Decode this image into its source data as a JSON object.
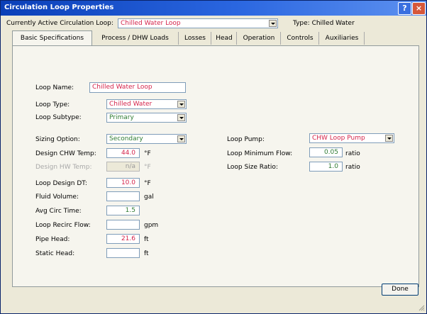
{
  "window": {
    "title": "Circulation Loop Properties",
    "help_label": "?",
    "close_label": "×"
  },
  "header": {
    "active_loop_label": "Currently Active Circulation Loop:",
    "active_loop_value": "Chilled Water Loop",
    "type_label": "Type: Chilled Water"
  },
  "tabs": [
    "Basic Specifications",
    "Process / DHW Loads",
    "Losses",
    "Head",
    "Operation",
    "Controls",
    "Auxiliaries"
  ],
  "form": {
    "loop_name": {
      "label": "Loop Name:",
      "value": "Chilled Water Loop"
    },
    "loop_type": {
      "label": "Loop Type:",
      "value": "Chilled Water"
    },
    "loop_subtype": {
      "label": "Loop Subtype:",
      "value": "Primary"
    },
    "sizing_option": {
      "label": "Sizing Option:",
      "value": "Secondary"
    },
    "design_chw_temp": {
      "label": "Design CHW Temp:",
      "value": "44.0",
      "unit": "°F"
    },
    "design_hw_temp": {
      "label": "Design HW Temp:",
      "value": "n/a",
      "unit": "°F"
    },
    "loop_design_dt": {
      "label": "Loop Design DT:",
      "value": "10.0",
      "unit": "°F"
    },
    "fluid_volume": {
      "label": "Fluid Volume:",
      "value": "",
      "unit": "gal"
    },
    "avg_circ_time": {
      "label": "Avg Circ Time:",
      "value": "1.5",
      "unit": ""
    },
    "loop_recirc_flow": {
      "label": "Loop Recirc Flow:",
      "value": "",
      "unit": "gpm"
    },
    "pipe_head": {
      "label": "Pipe Head:",
      "value": "21.6",
      "unit": "ft"
    },
    "static_head": {
      "label": "Static Head:",
      "value": "",
      "unit": "ft"
    },
    "loop_pump": {
      "label": "Loop Pump:",
      "value": "CHW Loop Pump"
    },
    "loop_minimum_flow": {
      "label": "Loop Minimum Flow:",
      "value": "0.05",
      "unit": "ratio"
    },
    "loop_size_ratio": {
      "label": "Loop Size Ratio:",
      "value": "1.0",
      "unit": "ratio"
    }
  },
  "footer": {
    "done_label": "Done"
  },
  "colors": {
    "title_bar": "#0a3fb8",
    "dialog_bg": "#ece9d8",
    "panel_bg": "#f6f5ee",
    "user_value": "#d4234a",
    "default_value": "#2e7b32"
  }
}
